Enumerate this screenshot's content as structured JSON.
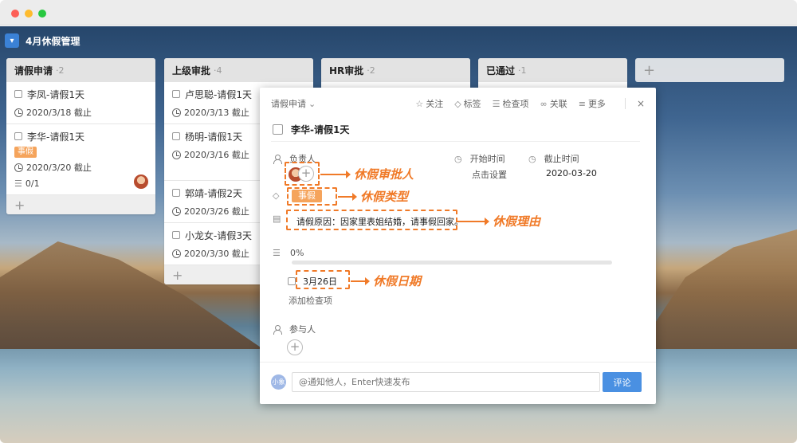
{
  "board": {
    "title": "4月休假管理",
    "toggle_icon": "chevron-down-icon"
  },
  "columns": [
    {
      "title": "请假申请",
      "count": "·2",
      "cards": [
        {
          "title": "李凤-请假1天",
          "due": "2020/3/18 截止"
        },
        {
          "title": "李华-请假1天",
          "tag": "事假",
          "due": "2020/3/20 截止",
          "checklist": "0/1"
        }
      ]
    },
    {
      "title": "上级审批",
      "count": "·4",
      "cards": [
        {
          "title": "卢思聪-请假1天",
          "due": "2020/3/13 截止"
        },
        {
          "title": "杨明-请假1天",
          "due": "2020/3/16 截止"
        },
        {
          "title": "郭靖-请假2天",
          "due": "2020/3/26 截止"
        },
        {
          "title": "小龙女-请假3天",
          "due": "2020/3/30 截止"
        }
      ]
    },
    {
      "title": "HR审批",
      "count": "·2"
    },
    {
      "title": "已通过",
      "count": "·1"
    }
  ],
  "add_symbol": "+",
  "modal": {
    "breadcrumb": "请假申请",
    "actions": [
      "关注",
      "标签",
      "检查项",
      "关联",
      "更多"
    ],
    "close": "×",
    "task_title": "李华-请假1天",
    "assignee_label": "负责人",
    "start_label": "开始时间",
    "start_value": "点击设置",
    "due_label": "截止时间",
    "due_value": "2020-03-20",
    "tag": "事假",
    "reason": "请假原因：因家里表姐结婚，请事假回家。",
    "progress": "0%",
    "progress_fraction": 0,
    "checklist_item": "3月26日",
    "add_checklist": "添加检查项",
    "participants_label": "参与人",
    "commenter_avatar": "小象",
    "comment_placeholder": "@通知他人，Enter快速发布",
    "comment_button": "评论"
  },
  "callouts": {
    "approver": "休假审批人",
    "type": "休假类型",
    "reason": "休假理由",
    "date": "休假日期"
  },
  "colors": {
    "accent": "#4a90e2",
    "tag": "#f5a45c",
    "annotation": "#f07a28"
  }
}
